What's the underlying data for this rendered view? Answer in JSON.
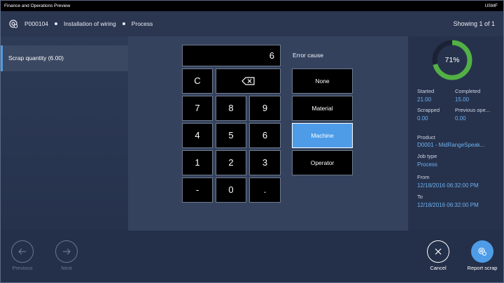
{
  "titlebar": {
    "app_title": "Finance and Operations Preview",
    "company": "USMF"
  },
  "header": {
    "breadcrumb": [
      "P000104",
      "Installation of wiring",
      "Process"
    ],
    "showing": "Showing 1 of 1"
  },
  "left": {
    "selected_item": "Scrap quantity (6.00)"
  },
  "keypad": {
    "display_value": "6",
    "clear": "C",
    "keys": [
      "7",
      "8",
      "9",
      "4",
      "5",
      "6",
      "1",
      "2",
      "3",
      "-",
      "0",
      "."
    ]
  },
  "error_cause": {
    "label": "Error cause",
    "options": [
      "None",
      "Material",
      "Machine",
      "Operator"
    ],
    "selected": "Machine"
  },
  "progress": {
    "percent_label": "71%",
    "fraction": 0.71,
    "color": "#52b045",
    "track_color": "#1b2236"
  },
  "details": {
    "started_label": "Started",
    "started_value": "21.00",
    "completed_label": "Completed",
    "completed_value": "15.00",
    "scrapped_label": "Scrapped",
    "scrapped_value": "0.00",
    "previous_label": "Previous ope...",
    "previous_value": "0.00",
    "product_label": "Product",
    "product_value": "D0001 - MidRangeSpeak...",
    "jobtype_label": "Job type",
    "jobtype_value": "Process",
    "from_label": "From",
    "from_value": "12/18/2016 06:32:00 PM",
    "to_label": "To",
    "to_value": "12/18/2016 06:32:00 PM"
  },
  "footer": {
    "previous": "Previous",
    "next": "Next",
    "cancel": "Cancel",
    "report_scrap": "Report scrap"
  },
  "colors": {
    "accent": "#4e9ce8",
    "value_text": "#6fb0f0"
  }
}
